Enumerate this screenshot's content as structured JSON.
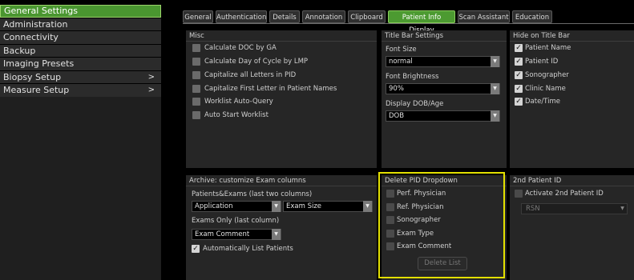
{
  "nav": {
    "items": [
      {
        "label": "General Settings",
        "active": true
      },
      {
        "label": "Administration"
      },
      {
        "label": "Connectivity"
      },
      {
        "label": "Backup"
      },
      {
        "label": "Imaging Presets"
      },
      {
        "label": "Biopsy Setup",
        "chevron": ">"
      },
      {
        "label": "Measure Setup",
        "chevron": ">"
      }
    ]
  },
  "tabs": [
    {
      "label": "General"
    },
    {
      "label": "Authentication"
    },
    {
      "label": "Details"
    },
    {
      "label": "Annotation"
    },
    {
      "label": "Clipboard"
    },
    {
      "label": "Patient Info Display",
      "active": true
    },
    {
      "label": "Scan Assistant"
    },
    {
      "label": "Education"
    }
  ],
  "misc": {
    "title": "Misc",
    "items": [
      {
        "label": "Calculate DOC by GA",
        "checked": false
      },
      {
        "label": "Calculate Day of Cycle by LMP",
        "checked": false
      },
      {
        "label": "Capitalize all Letters in PID",
        "checked": false
      },
      {
        "label": "Capitalize First Letter in Patient Names",
        "checked": false
      },
      {
        "label": "Worklist Auto-Query",
        "checked": false
      },
      {
        "label": "Auto Start Worklist",
        "checked": false
      }
    ]
  },
  "title_bar": {
    "title": "Title Bar Settings",
    "font_size_label": "Font Size",
    "font_size_value": "normal",
    "brightness_label": "Font Brightness",
    "brightness_value": "90%",
    "dob_label": "Display DOB/Age",
    "dob_value": "DOB"
  },
  "hide": {
    "title": "Hide on Title Bar",
    "items": [
      {
        "label": "Patient Name",
        "checked": true
      },
      {
        "label": "Patient ID",
        "checked": true
      },
      {
        "label": "Sonographer",
        "checked": true
      },
      {
        "label": "Clinic Name",
        "checked": true
      },
      {
        "label": "Date/Time",
        "checked": true
      }
    ]
  },
  "archive": {
    "title": "Archive: customize Exam columns",
    "pe_label": "Patients&Exams (last two columns)",
    "pe_col1": "Application",
    "pe_col2": "Exam Size",
    "eo_label": "Exams Only (last column)",
    "eo_col": "Exam Comment",
    "auto_list_label": "Automatically List Patients",
    "auto_list_checked": true
  },
  "delete_pid": {
    "title": "Delete PID Dropdown",
    "items": [
      {
        "label": "Perf. Physician"
      },
      {
        "label": "Ref. Physician"
      },
      {
        "label": "Sonographer"
      },
      {
        "label": "Exam Type"
      },
      {
        "label": "Exam Comment"
      }
    ],
    "button": "Delete List"
  },
  "second_pid": {
    "title": "2nd Patient ID",
    "activate_label": "Activate 2nd Patient ID",
    "select_value": "RSN"
  },
  "colors": {
    "accent_green": "#4c9a31",
    "highlight_yellow": "#e3e000",
    "panel_bg": "#262626"
  },
  "icons": {
    "check": "checkmark-icon",
    "dropdown": "triangle-down-icon",
    "submenu": "chevron-right-icon"
  }
}
